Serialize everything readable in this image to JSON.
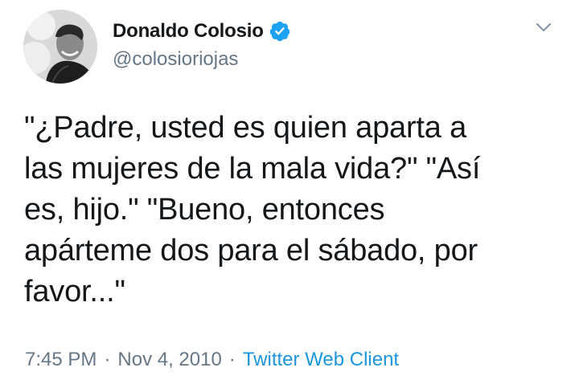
{
  "author": {
    "display_name": "Donaldo Colosio",
    "handle": "@colosioriojas",
    "verified": true
  },
  "tweet": {
    "text": "\"¿Padre, usted es quien aparta a\nlas mujeres de la mala vida?\" \"Así\nes, hijo.\" \"Bueno, entonces\napárteme dos para el sábado, por\nfavor...\"",
    "time": "7:45 PM",
    "date": "Nov 4, 2010",
    "separator": "·",
    "source": "Twitter Web Client"
  },
  "colors": {
    "text": "#14171a",
    "secondary": "#657786",
    "link": "#1b95e0",
    "verified": "#1da1f2"
  },
  "icons": {
    "verified": "verified-badge-icon",
    "menu": "chevron-down-icon"
  }
}
